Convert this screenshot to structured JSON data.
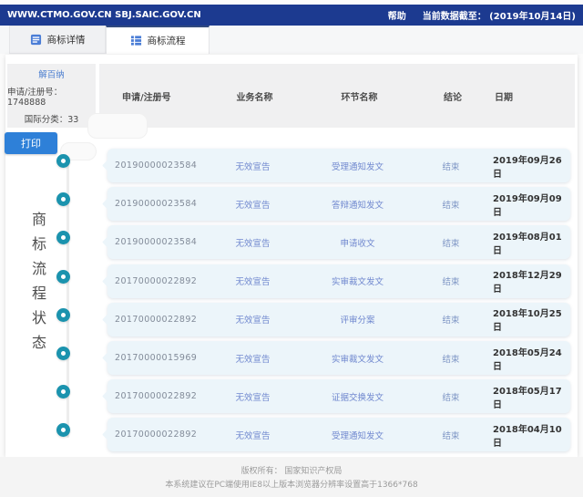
{
  "topbar": {
    "urls": "WWW.CTMO.GOV.CN SBJ.SAIC.GOV.CN",
    "help": "帮助",
    "data_as_of": "当前数据截至： (2019年10月14日)"
  },
  "tabs": [
    {
      "label": "商标详情",
      "active": false
    },
    {
      "label": "商标流程",
      "active": true
    }
  ],
  "trademark": {
    "name": "解百纳",
    "reg_line": "申请/注册号：1748888",
    "class_line": "国际分类：33"
  },
  "print_button": "打印",
  "side_title": "商标流程状态",
  "table": {
    "headers": [
      "申请/注册号",
      "业务名称",
      "环节名称",
      "结论",
      "日期"
    ],
    "rows": [
      [
        "20190000023584",
        "无效宣告",
        "受理通知发文",
        "结束",
        "2019年09月26日"
      ],
      [
        "20190000023584",
        "无效宣告",
        "答辩通知发文",
        "结束",
        "2019年09月09日"
      ],
      [
        "20190000023584",
        "无效宣告",
        "申请收文",
        "结束",
        "2019年08月01日"
      ],
      [
        "20170000022892",
        "无效宣告",
        "实审裁文发文",
        "结束",
        "2018年12月29日"
      ],
      [
        "20170000022892",
        "无效宣告",
        "评审分案",
        "结束",
        "2018年10月25日"
      ],
      [
        "20170000015969",
        "无效宣告",
        "实审裁文发文",
        "结束",
        "2018年05月24日"
      ],
      [
        "20170000022892",
        "无效宣告",
        "证据交换发文",
        "结束",
        "2018年05月17日"
      ],
      [
        "20170000022892",
        "无效宣告",
        "受理通知发文",
        "结束",
        "2018年04月10日"
      ]
    ]
  },
  "footer": {
    "line1": "版权所有： 国家知识产权局",
    "line2": "本系统建议在PC端使用IE8以上版本浏览器分辨率设置高于1366*768"
  },
  "colors": {
    "topbar_bg": "#1c3a90",
    "accent_blue": "#4a7dd6",
    "print_button_bg": "#2e80d8",
    "timeline_ring": "#1b93ae",
    "row_bg": "#ecf5fa",
    "row_text_blue": "#7088cf",
    "date_text": "#333333"
  }
}
